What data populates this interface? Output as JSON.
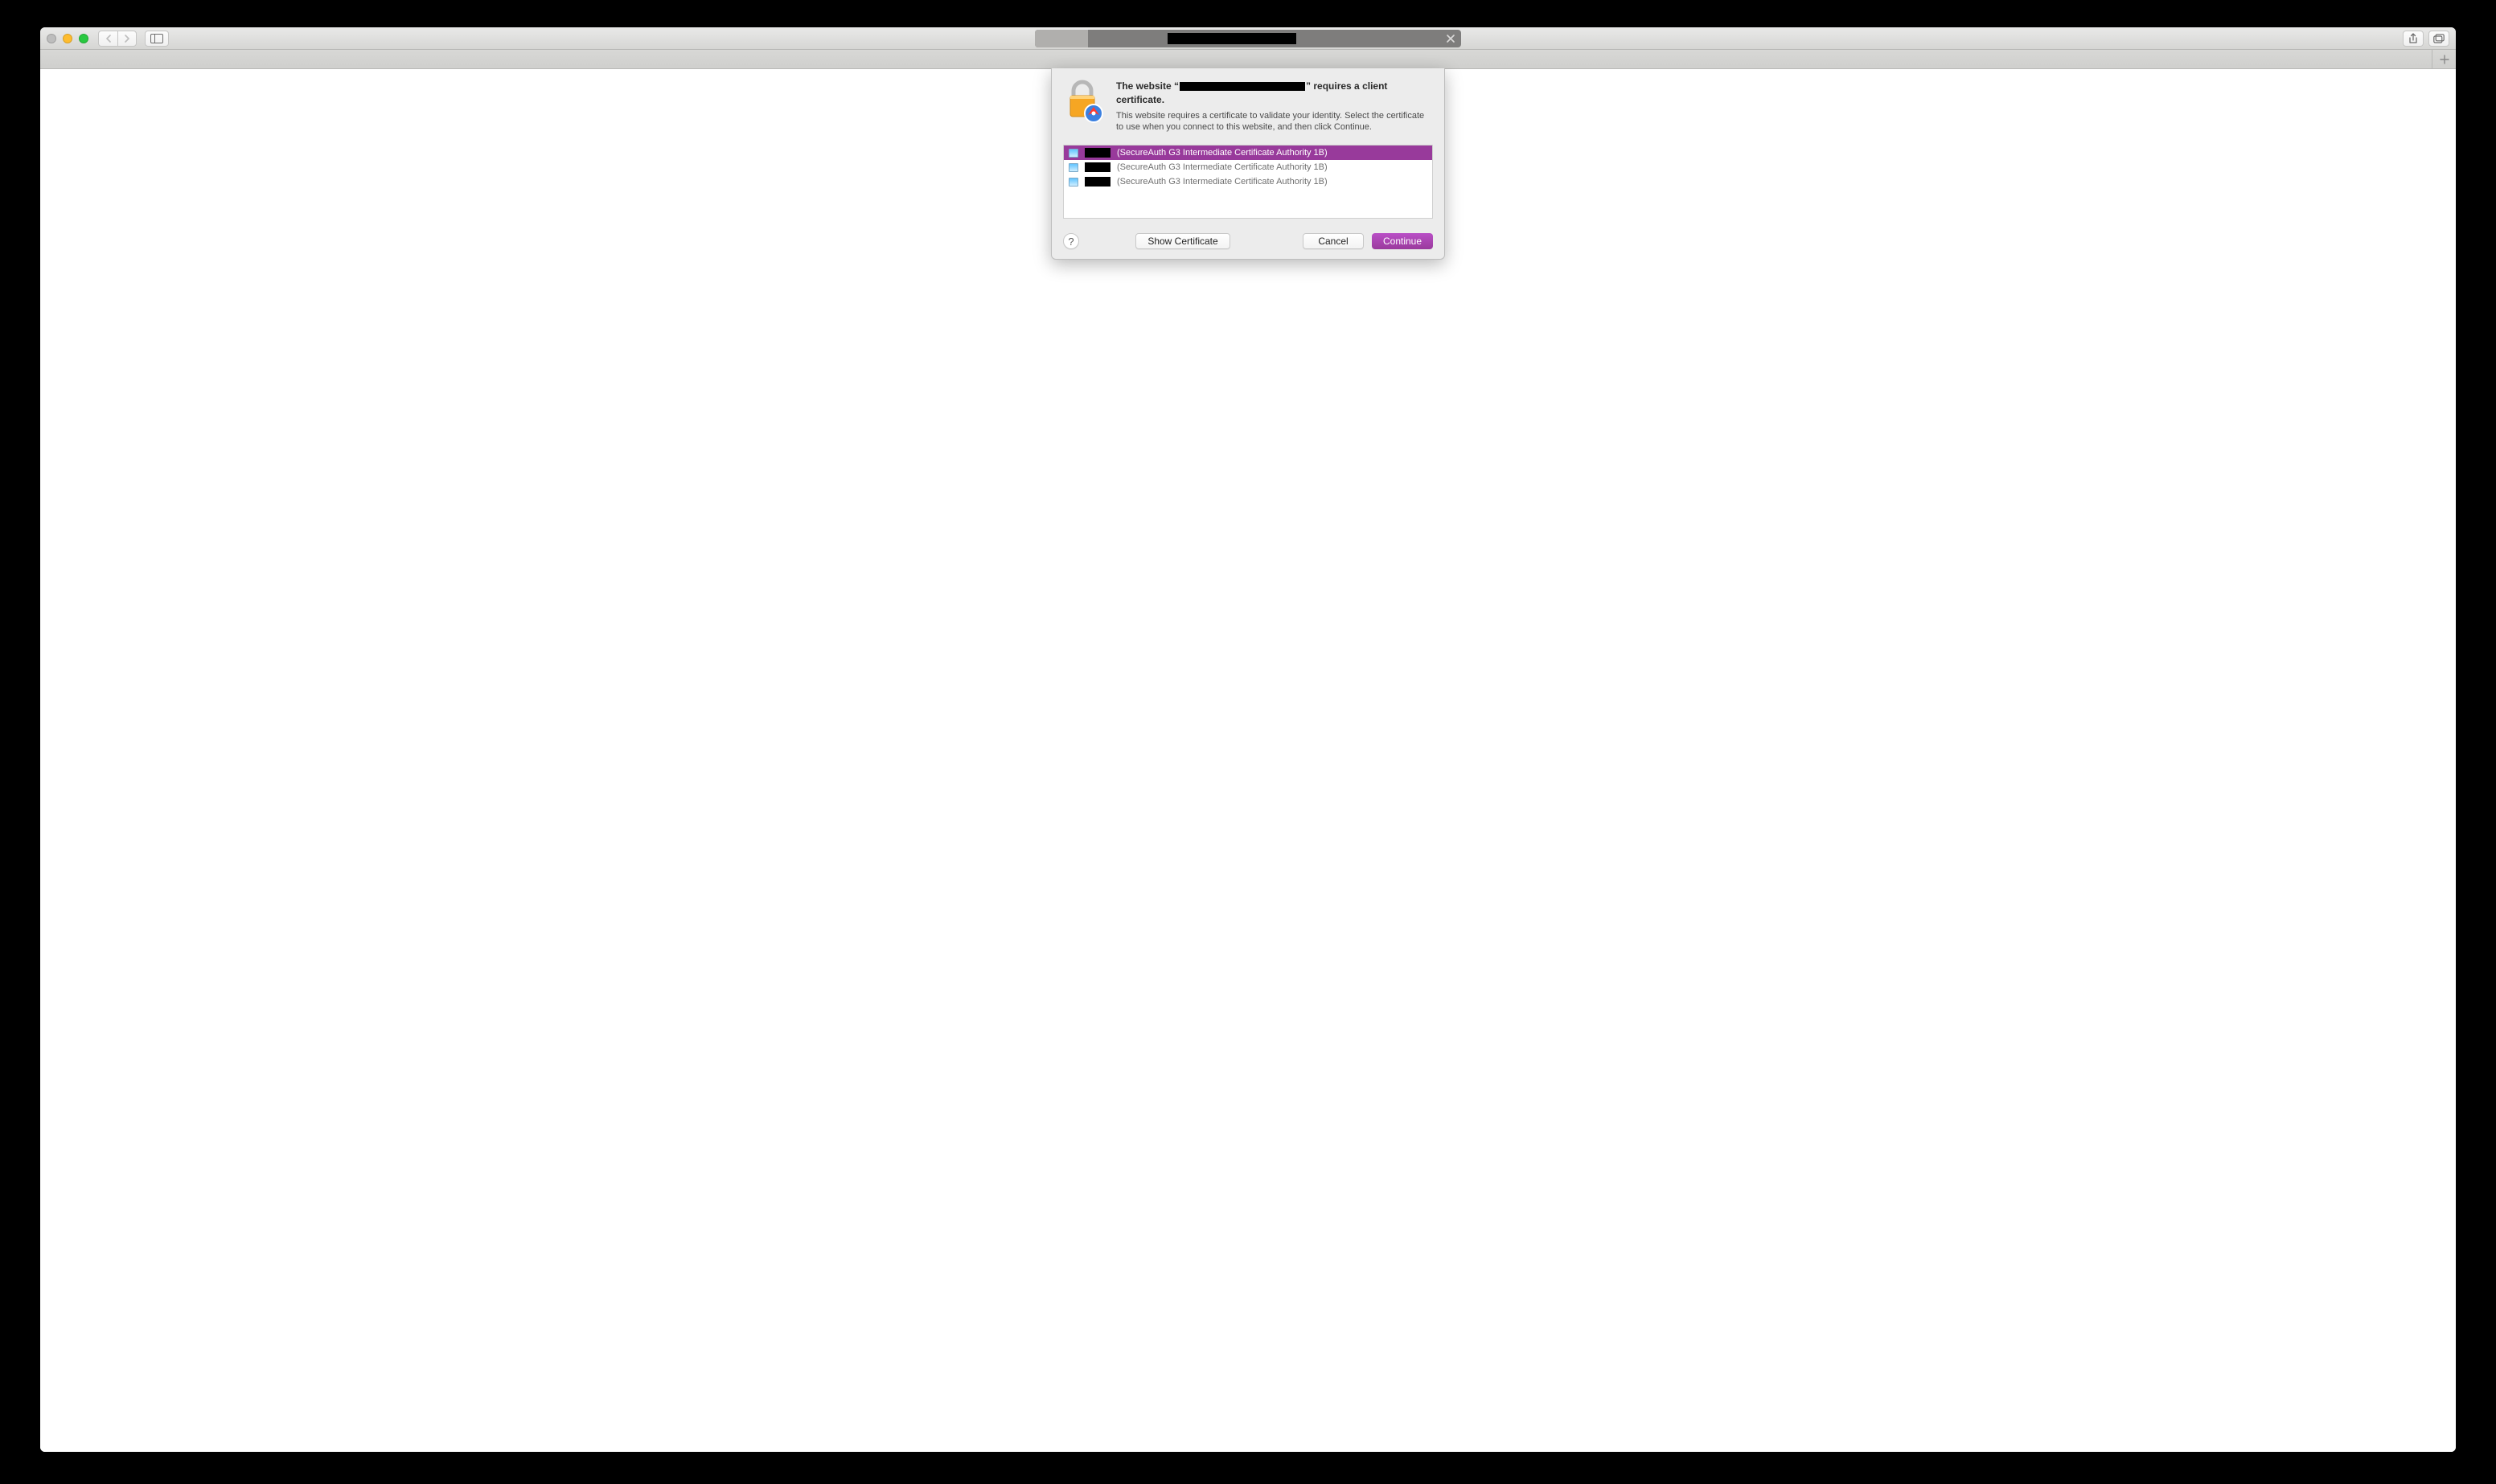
{
  "dialog": {
    "title_prefix": "The website “",
    "title_suffix": "” requires a client certificate.",
    "description": "This website requires a certificate to validate your identity. Select the certificate to use when you connect to this website, and then click Continue.",
    "certificates": [
      {
        "issuer": "(SecureAuth G3 Intermediate Certificate Authority 1B)",
        "selected": true
      },
      {
        "issuer": "(SecureAuth G3 Intermediate Certificate Authority 1B)",
        "selected": false
      },
      {
        "issuer": "(SecureAuth G3 Intermediate Certificate Authority 1B)",
        "selected": false
      }
    ],
    "buttons": {
      "show_certificate": "Show Certificate",
      "cancel": "Cancel",
      "continue": "Continue"
    }
  },
  "colors": {
    "selection": "#983a9b",
    "primary_button": "#9a3a9d"
  }
}
